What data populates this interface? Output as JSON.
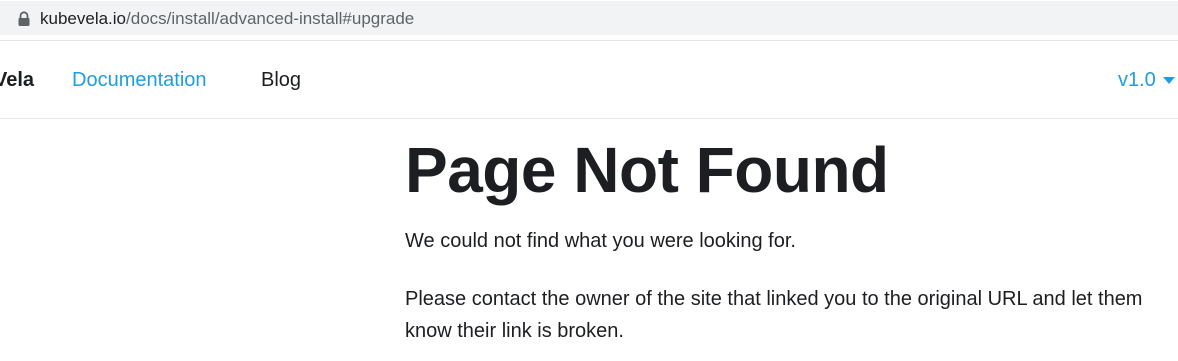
{
  "browser": {
    "url_host": "kubevela.io",
    "url_path": "/docs/install/advanced-install#upgrade",
    "icon": "lock-icon"
  },
  "navbar": {
    "brand": "Vela",
    "links": [
      "Documentation",
      "Blog"
    ],
    "version_label": "v1.0",
    "version_icon": "caret-down-icon",
    "accent_color": "#1e9ee0"
  },
  "main": {
    "title": "Page Not Found",
    "paragraphs": [
      "We could not find what you were looking for.",
      "Please contact the owner of the site that linked you to the original URL and let them know their link is broken."
    ]
  }
}
